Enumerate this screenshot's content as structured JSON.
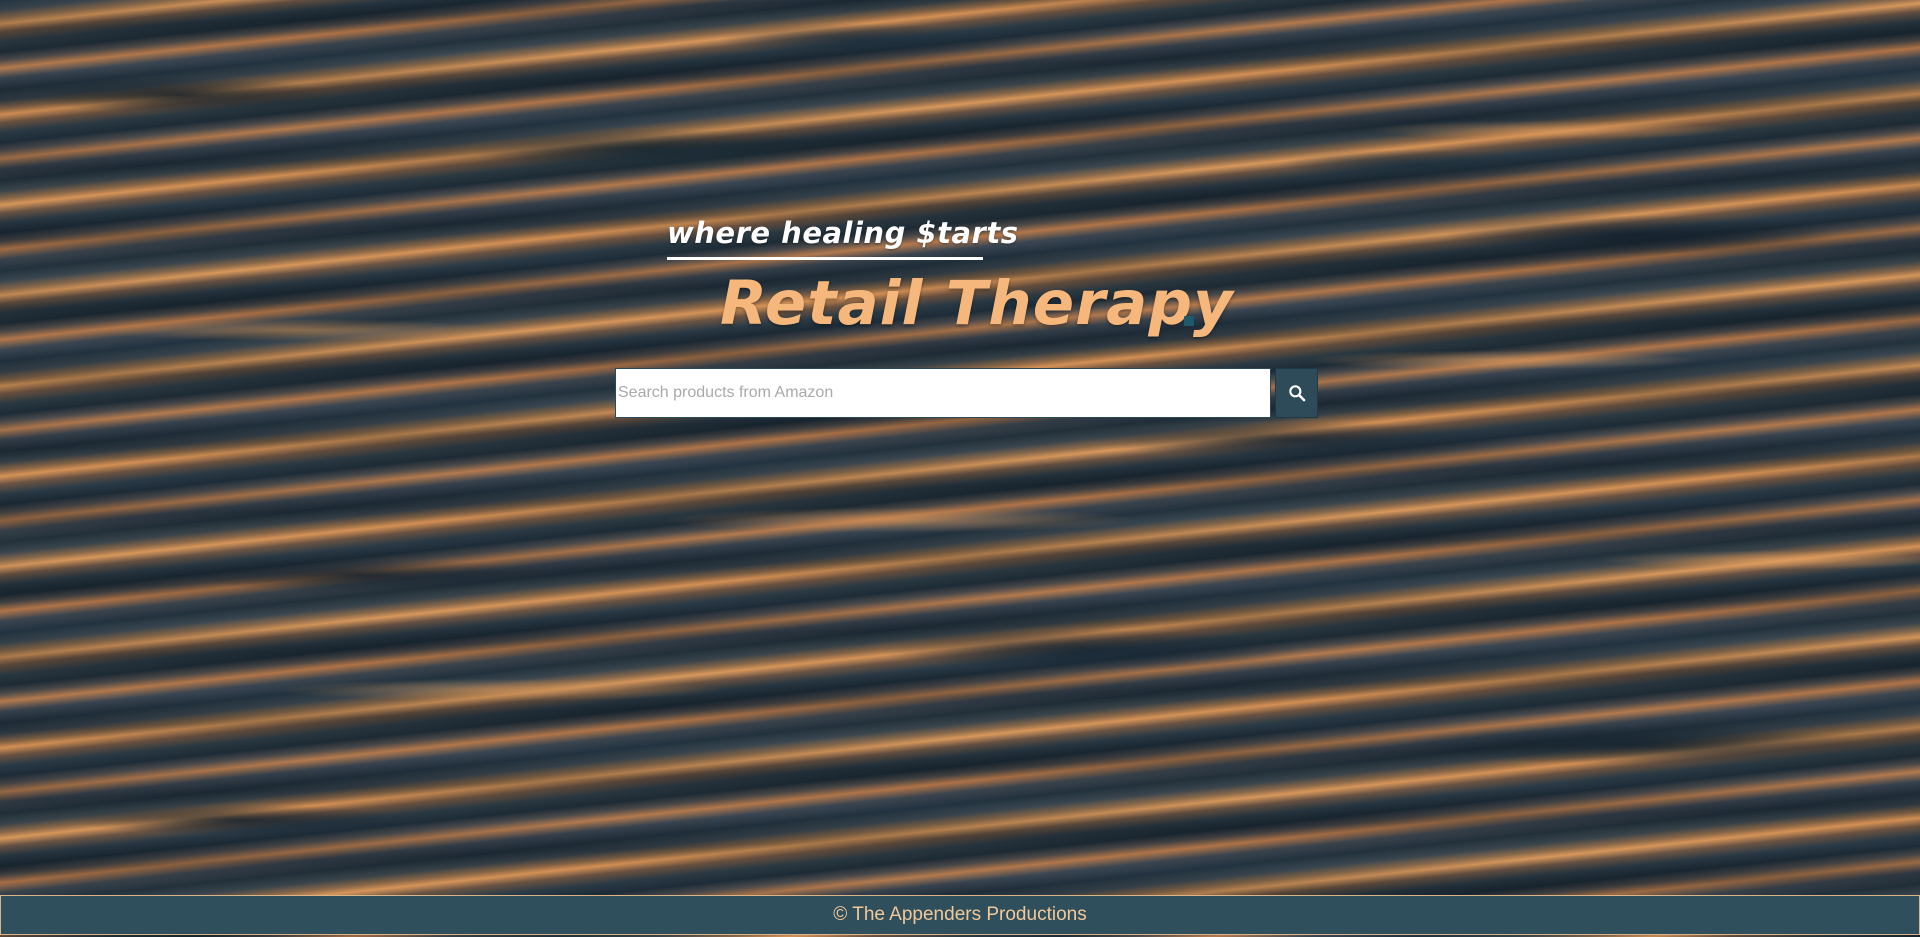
{
  "header": {
    "tagline": "where healing $tarts",
    "title": "Retail Therapy"
  },
  "search": {
    "placeholder": "Search products from Amazon",
    "value": "",
    "button_icon": "search-icon"
  },
  "footer": {
    "text": "© The Appenders Productions"
  },
  "colors": {
    "title": "#f6b77c",
    "tagline": "#ffffff",
    "search_button": "#2d4b58",
    "footer_background": "#2f4f5c",
    "footer_text": "#f2c89a",
    "footer_border": "#d9b48a"
  }
}
